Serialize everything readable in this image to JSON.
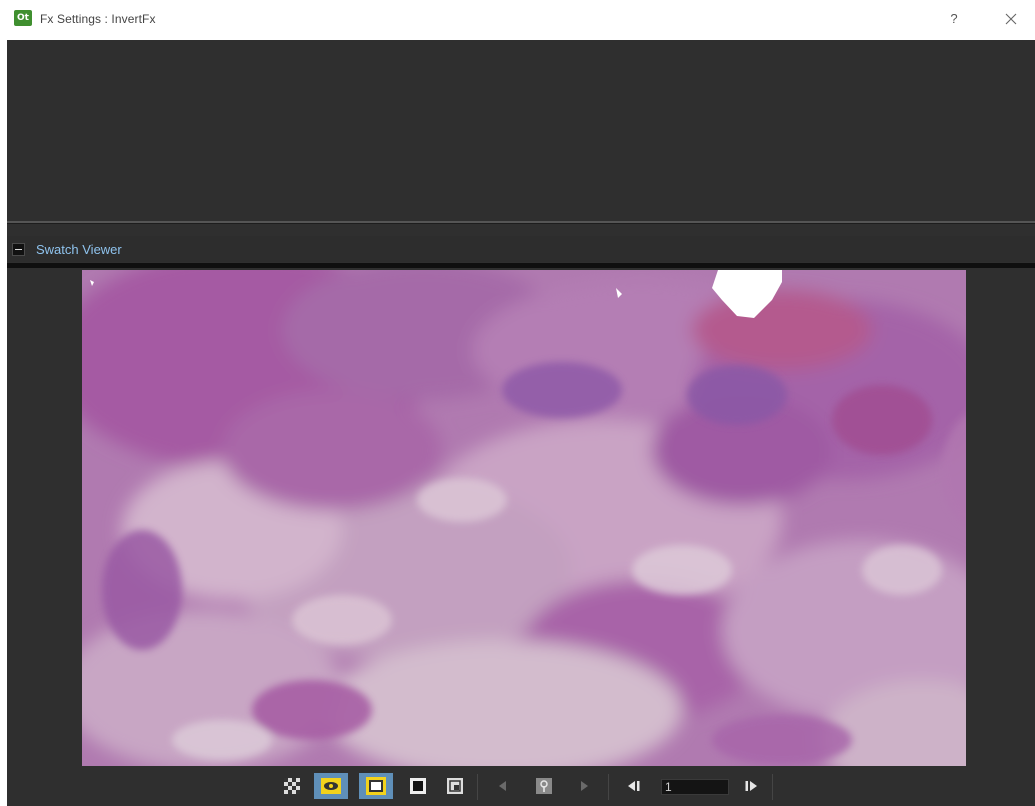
{
  "window": {
    "title": "Fx Settings : InvertFx",
    "logo_text": "Ot",
    "help_label": "?",
    "close_icon": "close-icon"
  },
  "panel": {
    "title": "Swatch Viewer",
    "collapse_icon": "minus-icon"
  },
  "viewer": {
    "content": "inverted-image-swatch"
  },
  "toolbar": {
    "buttons": [
      {
        "name": "checkerboard-bg-button",
        "icon": "checkerboard-icon",
        "active": false
      },
      {
        "name": "preview-toggle-button",
        "icon": "eye-icon",
        "active": true
      },
      {
        "name": "white-bg-button",
        "icon": "white-square-icon",
        "active": true
      },
      {
        "name": "black-bg-button",
        "icon": "black-square-icon",
        "active": false
      },
      {
        "name": "fit-view-button",
        "icon": "fit-icon",
        "active": false
      },
      {
        "name": "prev-key-button",
        "icon": "triangle-left-icon",
        "active": false
      },
      {
        "name": "set-key-button",
        "icon": "key-icon",
        "active": false
      },
      {
        "name": "next-key-button",
        "icon": "triangle-right-icon",
        "active": false
      },
      {
        "name": "prev-frame-button",
        "icon": "step-back-icon",
        "active": false
      },
      {
        "name": "next-frame-button",
        "icon": "step-forward-icon",
        "active": false
      }
    ],
    "frame_value": "1"
  },
  "colors": {
    "panel_bg": "#2f2f2f",
    "accent_yellow": "#f2d21c",
    "title_blue": "#8fc3ee",
    "swatch_base": "#b27cb0"
  }
}
